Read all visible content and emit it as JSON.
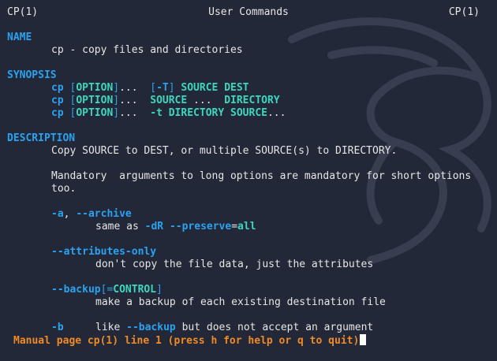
{
  "header": {
    "left": "CP(1)",
    "center": "User Commands",
    "right": "CP(1)"
  },
  "name": {
    "heading": "NAME",
    "text": "cp - copy files and directories"
  },
  "synopsis": {
    "heading": "SYNOPSIS",
    "lines": [
      {
        "cmd": "cp",
        "b1": "[",
        "option": "OPTION",
        "b2": "]",
        "dots": "...",
        "rest1": "[",
        "flag": "-T",
        "rest2": "]",
        "a1": "SOURCE",
        "a2": "DEST",
        "a3": ""
      },
      {
        "cmd": "cp",
        "b1": "[",
        "option": "OPTION",
        "b2": "]",
        "dots": "...",
        "a1": "SOURCE",
        "d2": "...",
        "a2": "DIRECTORY"
      },
      {
        "cmd": "cp",
        "b1": "[",
        "option": "OPTION",
        "b2": "]",
        "dots": "...",
        "flag": "-t",
        "a1": "DIRECTORY",
        "a2": "SOURCE",
        "d2": "..."
      }
    ]
  },
  "description": {
    "heading": "DESCRIPTION",
    "p1": "Copy SOURCE to DEST, or multiple SOURCE(s) to DIRECTORY.",
    "p2a": "Mandatory  arguments to long options are mandatory for short options",
    "p2b": "too.",
    "archive": {
      "short": "-a",
      "comma": ",",
      "long": "--archive",
      "desc_pre": "same as ",
      "flag1": "-dR",
      "flag2": "--preserve",
      "eq": "=",
      "val": "all"
    },
    "attributes_only": {
      "long": "--attributes-only",
      "desc": "don't copy the file data, just the attributes"
    },
    "backup": {
      "long": "--backup",
      "open": "[=",
      "arg": "CONTROL",
      "close": "]",
      "desc": "make a backup of each existing destination file"
    },
    "b": {
      "short": "-b",
      "desc_pre": "like ",
      "flag": "--backup",
      "desc_post": " but does not accept an argument"
    }
  },
  "status": {
    "text": "Manual page cp(1) line 1 (press h for help or q to quit)"
  },
  "colors": {
    "background": "#222838",
    "section": "#2aa2ef",
    "arg": "#3dd6c0",
    "status": "#f08a24"
  }
}
